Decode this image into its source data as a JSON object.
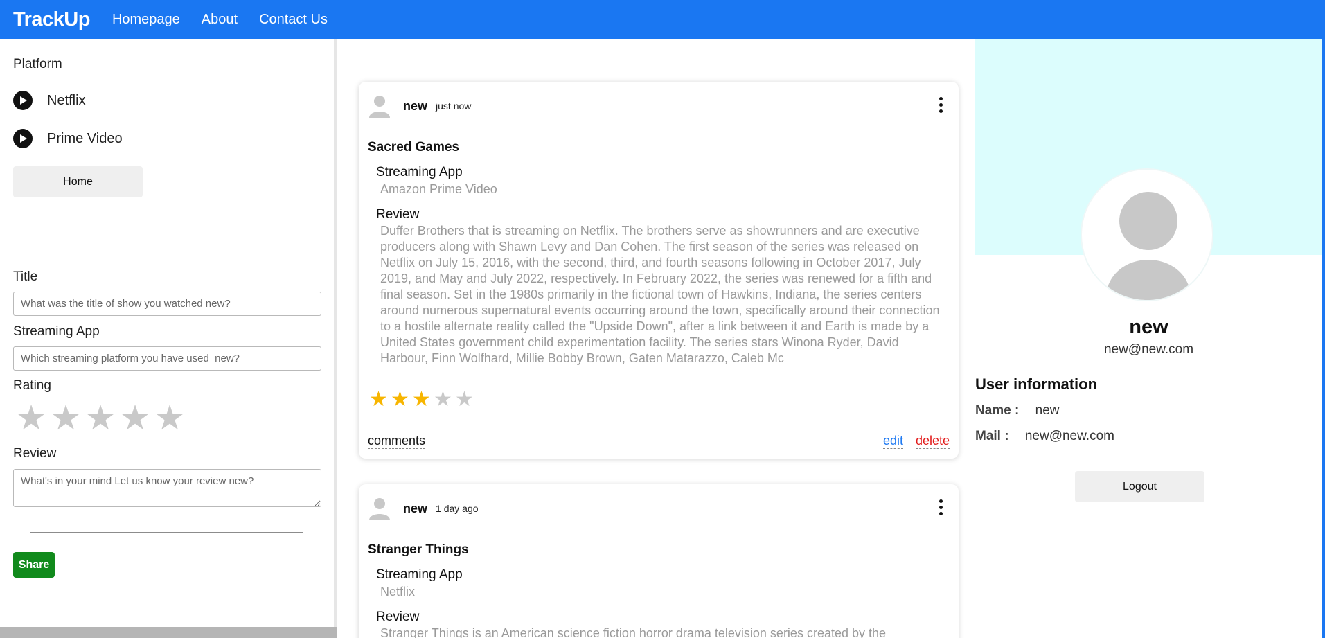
{
  "navbar": {
    "brand": "TrackUp",
    "links": [
      "Homepage",
      "About",
      "Contact Us"
    ]
  },
  "sidebar": {
    "platform_heading": "Platform",
    "platforms": [
      "Netflix",
      "Prime Video"
    ],
    "home_button": "Home",
    "form": {
      "title_label": "Title",
      "title_placeholder": "What was the title of show you watched new?",
      "app_label": "Streaming App",
      "app_placeholder": "Which streaming platform you have used  new?",
      "rating_label": "Rating",
      "rating_value": 0,
      "rating_max": 5,
      "review_label": "Review",
      "review_placeholder": "What's in your mind Let us know your review new?",
      "share_button": "Share"
    }
  },
  "feed": {
    "posts": [
      {
        "user": "new",
        "time": "just now",
        "title": "Sacred Games",
        "app_label": "Streaming App",
        "app_value": "Amazon Prime Video",
        "review_label": "Review",
        "review_text": "Duffer Brothers that is streaming on Netflix. The brothers serve as showrunners and are executive producers along with Shawn Levy and Dan Cohen. The first season of the series was released on Netflix on July 15, 2016, with the second, third, and fourth seasons following in October 2017, July 2019, and May and July 2022, respectively. In February 2022, the series was renewed for a fifth and final season. Set in the 1980s primarily in the fictional town of Hawkins, Indiana, the series centers around numerous supernatural events occurring around the town, specifically around their connection to a hostile alternate reality called the \"Upside Down\", after a link between it and Earth is made by a United States government child experimentation facility. The series stars Winona Ryder, David Harbour, Finn Wolfhard, Millie Bobby Brown, Gaten Matarazzo, Caleb Mc",
        "rating": 3,
        "rating_max": 5,
        "comments_label": "comments",
        "edit_label": "edit",
        "delete_label": "delete"
      },
      {
        "user": "new",
        "time": "1 day ago",
        "title": "Stranger Things",
        "app_label": "Streaming App",
        "app_value": "Netflix",
        "review_label": "Review",
        "review_text": "Stranger Things is an American science fiction horror drama television series created by the"
      }
    ]
  },
  "profile": {
    "name": "new",
    "email": "new@new.com",
    "info_heading": "User information",
    "name_key": "Name :",
    "name_value": "new",
    "mail_key": "Mail :",
    "mail_value": "new@new.com",
    "logout_button": "Logout"
  },
  "colors": {
    "primary": "#1a77f2",
    "cover": "#dcfdfd",
    "share": "#118a1c",
    "star_on": "#f7b500",
    "star_off": "#c9c9c9",
    "delete": "#e21b1b"
  },
  "icons": [
    "play-circle-icon",
    "user-avatar-icon",
    "star-icon",
    "more-vertical-icon"
  ]
}
